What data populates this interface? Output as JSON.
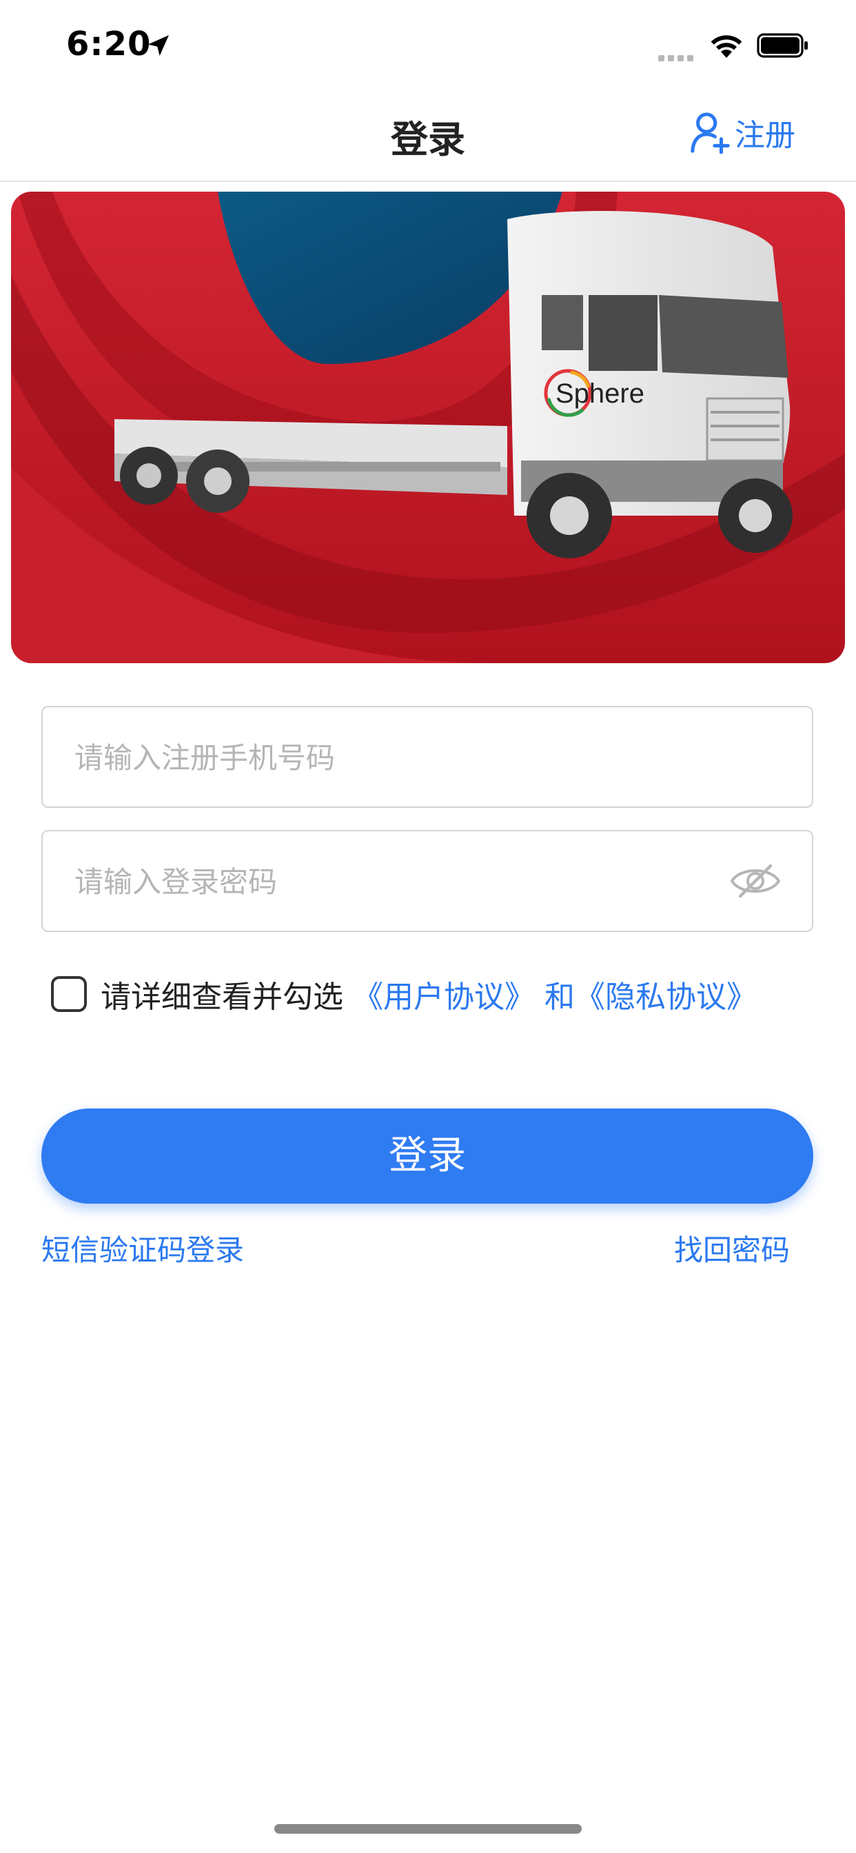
{
  "status_bar": {
    "time": "6:20"
  },
  "nav": {
    "title": "登录",
    "register_label": "注册"
  },
  "banner": {
    "logo_text": "Sphere"
  },
  "form": {
    "phone_placeholder": "请输入注册手机号码",
    "password_placeholder": "请输入登录密码",
    "agreement": {
      "prefix": "请详细查看并勾选",
      "user_agreement": "《用户协议》",
      "and": "和",
      "privacy_agreement": "《隐私协议》",
      "checked": false
    },
    "login_label": "登录",
    "sms_login_label": "短信验证码登录",
    "forgot_password_label": "找回密码"
  },
  "colors": {
    "accent": "#2f7bf2",
    "link": "#2b79f0",
    "banner_red": "#c5202b",
    "banner_blue": "#0f4f7a"
  },
  "icons": [
    "location-arrow-icon",
    "wifi-icon",
    "battery-icon",
    "user-add-icon",
    "eye-off-icon"
  ]
}
